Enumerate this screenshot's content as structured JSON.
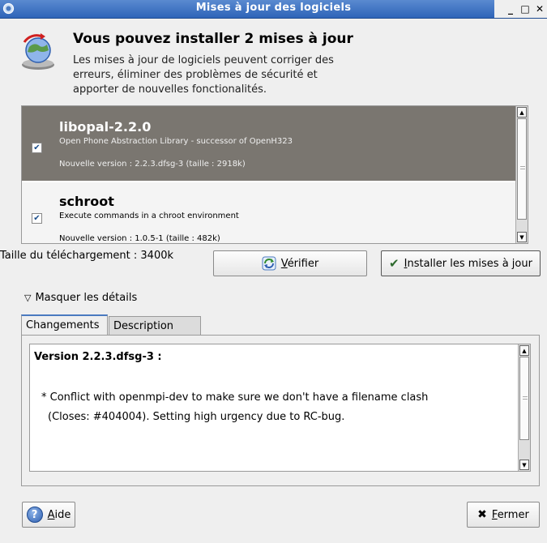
{
  "window": {
    "title": "Mises à jour des logiciels",
    "controls": {
      "minimize": "_",
      "maximize": "□",
      "close": "✕"
    }
  },
  "header": {
    "title": "Vous pouvez installer 2 mises à jour",
    "description": "Les mises à jour de logiciels peuvent corriger des erreurs, éliminer des problèmes de sécurité et apporter de nouvelles fonctionalités."
  },
  "updates": [
    {
      "name": "libopal-2.2.0",
      "summary": "Open Phone Abstraction Library - successor of OpenH323",
      "version": "Nouvelle version : 2.2.3.dfsg-3 (taille : 2918k)",
      "checked": true,
      "selected": true
    },
    {
      "name": "schroot",
      "summary": "Execute commands in a chroot environment",
      "version": "Nouvelle version : 1.0.5-1 (taille : 482k)",
      "checked": true,
      "selected": false
    }
  ],
  "download_size": "Taille du téléchargement : 3400k",
  "buttons": {
    "check": {
      "mnemonic": "V",
      "rest": "érifier"
    },
    "install": {
      "mnemonic": "I",
      "rest": "nstaller les mises à jour"
    },
    "help": {
      "mnemonic": "A",
      "rest": "ide"
    },
    "close": {
      "mnemonic": "F",
      "rest": "ermer"
    }
  },
  "details_toggle": "Masquer les détails",
  "tabs": [
    {
      "label": "Changements",
      "active": true
    },
    {
      "label": "Description",
      "active": false
    }
  ],
  "changelog": {
    "heading": "Version 2.2.3.dfsg-3 :",
    "line1": "* Conflict with openmpi-dev to make sure we don't have a filename clash",
    "line2": "(Closes: #404004). Setting high urgency due to RC-bug."
  },
  "icons": {
    "app": "update-manager-icon",
    "header": "globe-update-icon",
    "check": "refresh-icon",
    "install": "checkmark-icon",
    "help": "help-icon",
    "close": "x-icon"
  },
  "colors": {
    "titlebar": "#2e64b8",
    "selected_row": "#7a7670",
    "window_bg": "#efefef"
  }
}
